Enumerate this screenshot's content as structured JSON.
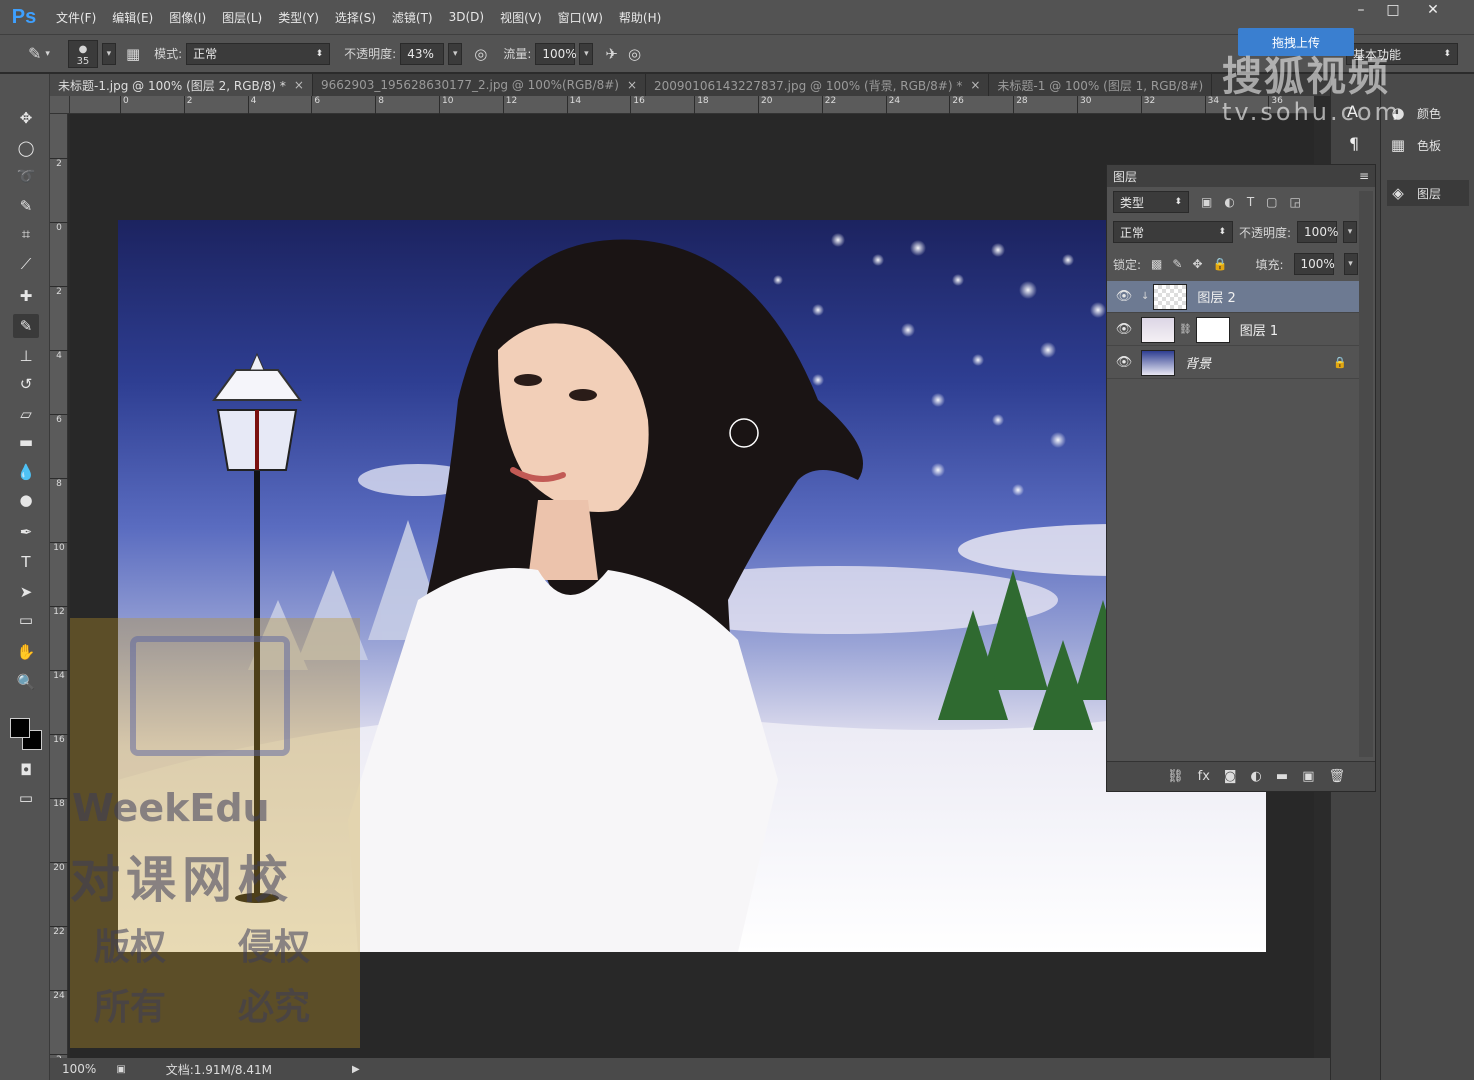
{
  "app": {
    "logo": "Ps"
  },
  "menu": [
    "文件(F)",
    "编辑(E)",
    "图像(I)",
    "图层(L)",
    "类型(Y)",
    "选择(S)",
    "滤镜(T)",
    "3D(D)",
    "视图(V)",
    "窗口(W)",
    "帮助(H)"
  ],
  "window_controls": {
    "minimize": "–",
    "maximize": "□",
    "close": "✕"
  },
  "options": {
    "brush_size": "35",
    "mode_label": "模式:",
    "mode_value": "正常",
    "opacity_label": "不透明度:",
    "opacity_value": "43%",
    "flow_label": "流量:",
    "flow_value": "100%",
    "workspace": "基本功能"
  },
  "tabs": [
    {
      "label": "未标题-1.jpg @ 100% (图层 2, RGB/8) *",
      "active": true
    },
    {
      "label": "9662903_195628630177_2.jpg @ 100%(RGB/8#)",
      "active": false
    },
    {
      "label": "20090106143227837.jpg @ 100% (背景, RGB/8#) *",
      "active": false
    },
    {
      "label": "未标题-1 @ 100% (图层 1, RGB/8#)",
      "active": false
    }
  ],
  "ruler_h": [
    "0",
    "2",
    "4",
    "6",
    "8",
    "10",
    "12",
    "14",
    "16",
    "18",
    "20",
    "22",
    "24",
    "26",
    "28",
    "30",
    "32",
    "34",
    "36"
  ],
  "ruler_v": [
    "2",
    "0",
    "2",
    "4",
    "6",
    "8",
    "10",
    "12",
    "14",
    "16",
    "18",
    "20",
    "22",
    "24",
    "2"
  ],
  "status": {
    "zoom": "100%",
    "doc": "文档:1.91M/8.41M"
  },
  "dock": {
    "color": "颜色",
    "swatches": "色板",
    "layers": "图层"
  },
  "layers_panel": {
    "title": "图层",
    "filter": "类型",
    "blend": "正常",
    "opacity_label": "不透明度:",
    "opacity": "100%",
    "lock_label": "锁定:",
    "fill_label": "填充:",
    "fill": "100%",
    "layers": [
      {
        "name": "图层 2",
        "selected": true
      },
      {
        "name": "图层 1",
        "selected": false
      },
      {
        "name": "背景",
        "selected": false
      }
    ],
    "footer": [
      "⛓",
      "fx",
      "◙",
      "◐",
      "▬",
      "▣",
      "🗑"
    ]
  },
  "watermark": {
    "sohu_badge": "拖拽上传",
    "sohu_name": "搜狐视频",
    "sohu_url": "tv.sohu.com",
    "brand": "WeekEdu",
    "cn_name": "对课网校",
    "rights1": "版权",
    "rights2": "侵权",
    "rights3": "所有",
    "rights4": "必究"
  },
  "colors": {
    "ui_dark": "#535353",
    "canvas": "#282828",
    "selected_layer": "#6d7a92",
    "ps_blue": "#3ea0ff"
  }
}
